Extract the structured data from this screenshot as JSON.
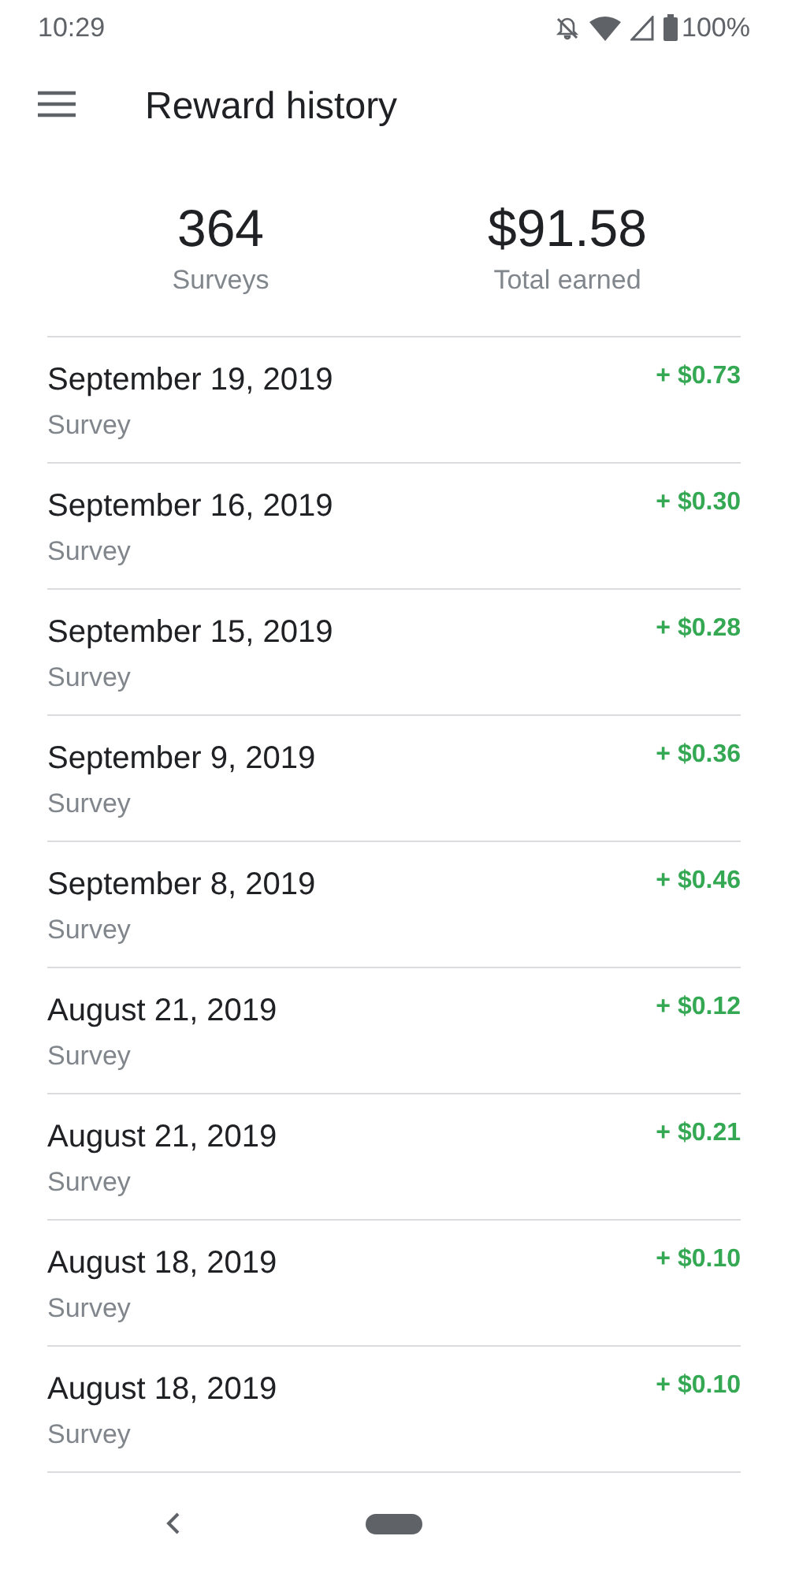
{
  "status_bar": {
    "time": "10:29",
    "battery": "100%"
  },
  "app_bar": {
    "title": "Reward history"
  },
  "summary": [
    {
      "value": "364",
      "label": "Surveys"
    },
    {
      "value": "$91.58",
      "label": "Total earned"
    }
  ],
  "rewards": [
    {
      "date": "September 19, 2019",
      "type": "Survey",
      "amount": "+ $0.73"
    },
    {
      "date": "September 16, 2019",
      "type": "Survey",
      "amount": "+ $0.30"
    },
    {
      "date": "September 15, 2019",
      "type": "Survey",
      "amount": "+ $0.28"
    },
    {
      "date": "September 9, 2019",
      "type": "Survey",
      "amount": "+ $0.36"
    },
    {
      "date": "September 8, 2019",
      "type": "Survey",
      "amount": "+ $0.46"
    },
    {
      "date": "August 21, 2019",
      "type": "Survey",
      "amount": "+ $0.12"
    },
    {
      "date": "August 21, 2019",
      "type": "Survey",
      "amount": "+ $0.21"
    },
    {
      "date": "August 18, 2019",
      "type": "Survey",
      "amount": "+ $0.10"
    },
    {
      "date": "August 18, 2019",
      "type": "Survey",
      "amount": "+ $0.10"
    }
  ]
}
